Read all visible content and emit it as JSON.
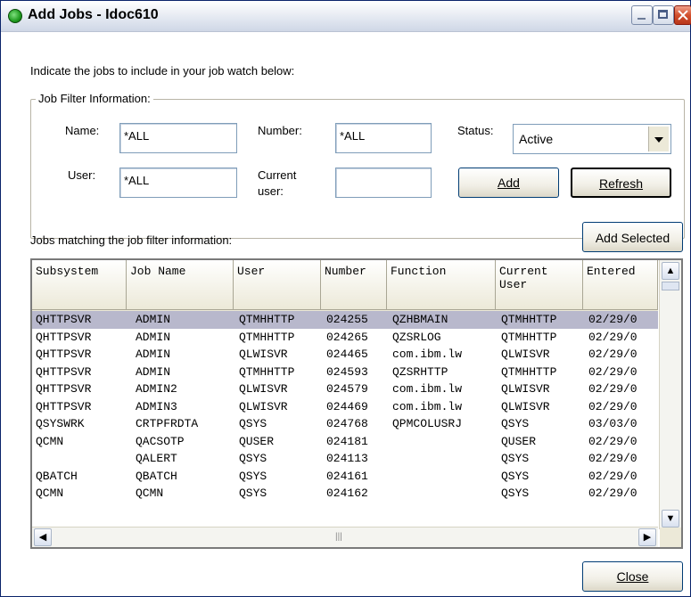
{
  "window": {
    "title": "Add Jobs - Idoc610"
  },
  "intro": "Indicate the jobs to include in your job watch below:",
  "filter": {
    "legend": "Job Filter Information:",
    "name_label": "Name:",
    "name_value": "*ALL",
    "number_label": "Number:",
    "number_value": "*ALL",
    "status_label": "Status:",
    "status_value": "Active",
    "user_label": "User:",
    "user_value": "*ALL",
    "current_user_label_1": "Current",
    "current_user_label_2": "user:",
    "current_user_value": "",
    "add_label": "Add",
    "refresh_label": "Refresh"
  },
  "matching_label": "Jobs matching the job filter information:",
  "add_selected_label": "Add Selected",
  "table": {
    "headers": [
      "Subsystem",
      "Job Name",
      "User",
      "Number",
      "Function",
      "Current User",
      "Entered"
    ],
    "rows": [
      [
        "QHTTPSVR",
        "ADMIN",
        "QTMHHTTP",
        "024255",
        "QZHBMAIN",
        "QTMHHTTP",
        "02/29/0"
      ],
      [
        "QHTTPSVR",
        "ADMIN",
        "QTMHHTTP",
        "024265",
        "QZSRLOG",
        "QTMHHTTP",
        "02/29/0"
      ],
      [
        "QHTTPSVR",
        "ADMIN",
        "QLWISVR",
        "024465",
        "com.ibm.lw",
        "QLWISVR",
        "02/29/0"
      ],
      [
        "QHTTPSVR",
        "ADMIN",
        "QTMHHTTP",
        "024593",
        "QZSRHTTP",
        "QTMHHTTP",
        "02/29/0"
      ],
      [
        "QHTTPSVR",
        "ADMIN2",
        "QLWISVR",
        "024579",
        "com.ibm.lw",
        "QLWISVR",
        "02/29/0"
      ],
      [
        "QHTTPSVR",
        "ADMIN3",
        "QLWISVR",
        "024469",
        "com.ibm.lw",
        "QLWISVR",
        "02/29/0"
      ],
      [
        "QSYSWRK",
        "CRTPFRDTA",
        "QSYS",
        "024768",
        "QPMCOLUSRJ",
        "QSYS",
        "03/03/0"
      ],
      [
        "QCMN",
        "QACSOTP",
        "QUSER",
        "024181",
        "",
        "QUSER",
        "02/29/0"
      ],
      [
        "",
        "QALERT",
        "QSYS",
        "024113",
        "",
        "QSYS",
        "02/29/0"
      ],
      [
        "QBATCH",
        "QBATCH",
        "QSYS",
        "024161",
        "",
        "QSYS",
        "02/29/0"
      ],
      [
        "QCMN",
        "QCMN",
        "QSYS",
        "024162",
        "",
        "QSYS",
        "02/29/0"
      ]
    ],
    "selected_row": 0
  },
  "close_label": "Close",
  "icons": [
    "app-icon",
    "minimize-icon",
    "maximize-icon",
    "close-icon",
    "scroll-up-icon",
    "scroll-down-icon",
    "scroll-left-icon",
    "scroll-right-icon",
    "dropdown-arrow-icon"
  ]
}
